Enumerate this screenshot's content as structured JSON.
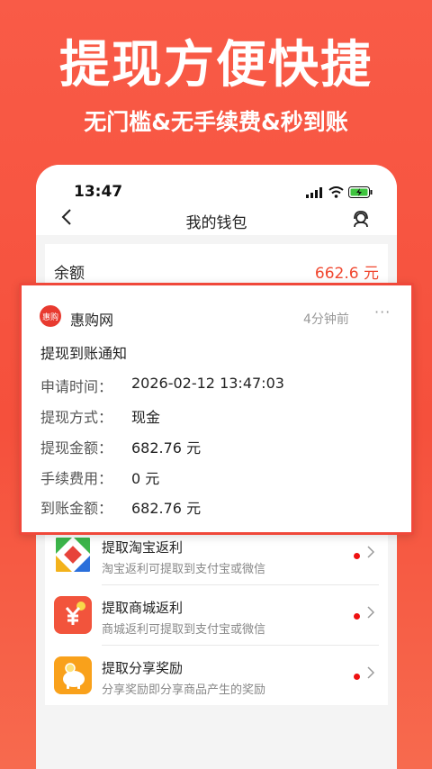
{
  "promo": {
    "title": "提现方便快捷",
    "subtitle": "无门槛&无手续费&秒到账"
  },
  "status_bar": {
    "time": "13:47"
  },
  "nav": {
    "title": "我的钱包"
  },
  "balance": {
    "label": "余额",
    "value": "662.6 元"
  },
  "notification": {
    "app_logo_text": "惠购",
    "app_name": "惠购网",
    "time": "4分钟前",
    "more": "···",
    "heading": "提现到账通知",
    "rows": [
      {
        "key": "申请时间：",
        "value": "2026-02-12 13:47:03"
      },
      {
        "key": "提现方式：",
        "value": "现金"
      },
      {
        "key": "提现金额：",
        "value": "682.76 元"
      },
      {
        "key": "手续费用：",
        "value": "0 元"
      },
      {
        "key": "到账金额：",
        "value": "682.76 元"
      }
    ]
  },
  "withdraw_list": [
    {
      "title": "提取淘宝返利",
      "desc": "淘宝返利可提取到支付宝或微信",
      "icon": "taobao-icon"
    },
    {
      "title": "提取商城返利",
      "desc": "商城返利可提取到支付宝或微信",
      "icon": "yuan-icon"
    },
    {
      "title": "提取分享奖励",
      "desc": "分享奖励即分享商品产生的奖励",
      "icon": "piggy-bank-icon"
    }
  ],
  "colors": {
    "accent": "#f0472f",
    "background": "#f95b47",
    "notice_border": "#f0483a"
  }
}
